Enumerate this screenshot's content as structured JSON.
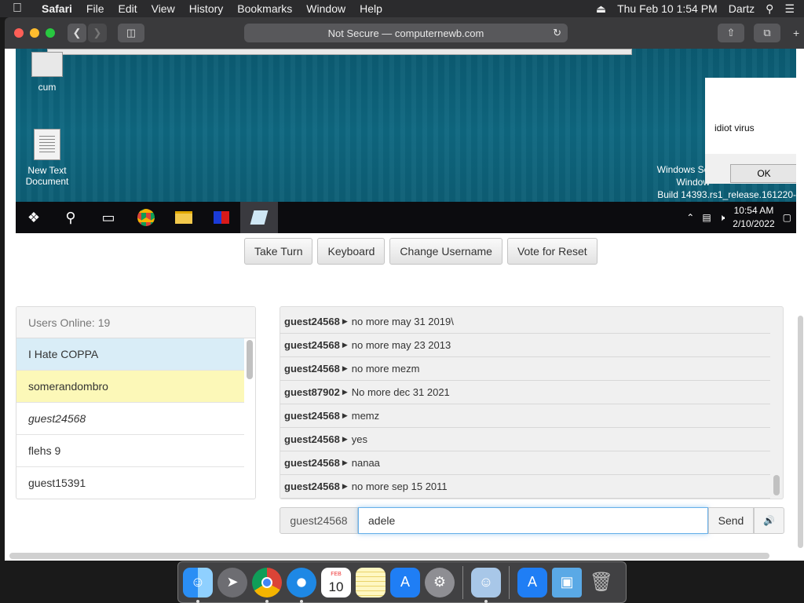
{
  "menubar": {
    "app": "Safari",
    "items": [
      "File",
      "Edit",
      "View",
      "History",
      "Bookmarks",
      "Window",
      "Help"
    ],
    "datetime": "Thu Feb 10  1:54 PM",
    "user": "Dartz"
  },
  "browser": {
    "address": "Not Secure — computernewb.com"
  },
  "vm": {
    "desktop_icons": [
      {
        "label": "cum",
        "icon": "gear-icon"
      },
      {
        "label": "New Text Document",
        "icon": "text-document-icon"
      }
    ],
    "watermark_line1": "Windows Server",
    "watermark_line2": "Window",
    "watermark_line3": "Build 14393.rs1_release.161220-",
    "dialog_text": "idiot virus",
    "dialog_ok": "OK",
    "clock_time": "10:54 AM",
    "clock_date": "2/10/2022"
  },
  "controls": {
    "take_turn": "Take Turn",
    "keyboard": "Keyboard",
    "change_username": "Change Username",
    "vote_reset": "Vote for Reset"
  },
  "users": {
    "header": "Users Online: 19",
    "list": [
      {
        "name": "I Hate COPPA"
      },
      {
        "name": "somerandombro"
      },
      {
        "name": "guest24568"
      },
      {
        "name": "flehs 9"
      },
      {
        "name": "guest15391"
      }
    ]
  },
  "chat": {
    "messages": [
      {
        "user": "guest24568",
        "text": "no more may 31 2019\\"
      },
      {
        "user": "guest24568",
        "text": "no more may 23 2013"
      },
      {
        "user": "guest24568",
        "text": "no more mezm"
      },
      {
        "user": "guest87902",
        "text": "No more dec 31 2021"
      },
      {
        "user": "guest24568",
        "text": "memz"
      },
      {
        "user": "guest24568",
        "text": "yes"
      },
      {
        "user": "guest24568",
        "text": "nanaa"
      },
      {
        "user": "guest24568",
        "text": "no more sep 15 2011"
      }
    ],
    "username": "guest24568",
    "input_value": "adele",
    "send": "Send"
  },
  "dock": {
    "calendar_month": "FEB",
    "calendar_day": "10"
  }
}
